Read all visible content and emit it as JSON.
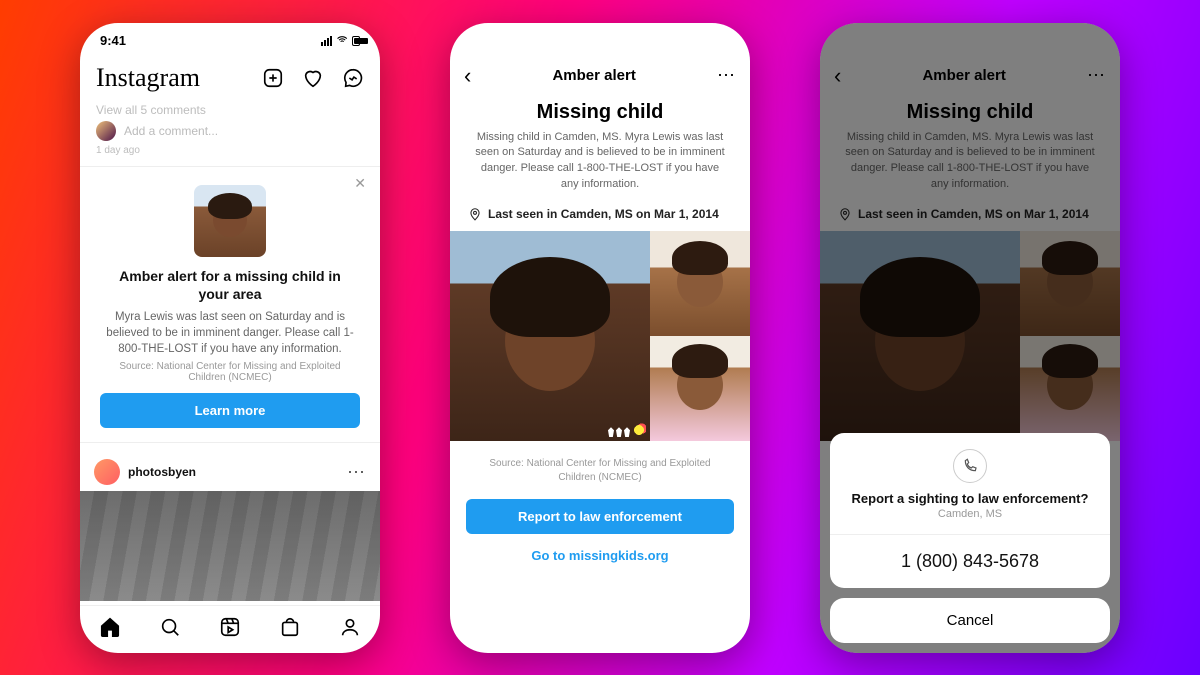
{
  "statusbar": {
    "time": "9:41"
  },
  "phone1": {
    "logo": "Instagram",
    "view_all": "View all 5 comments",
    "add_comment_placeholder": "Add a comment...",
    "timestamp": "1 day ago",
    "alert": {
      "title": "Amber alert for a missing child in your area",
      "body": "Myra Lewis was last seen on Saturday and is believed to be in imminent danger. Please call 1-800-THE-LOST if you have any information.",
      "source": "Source: National Center for Missing and Exploited Children (NCMEC)",
      "cta": "Learn more"
    },
    "post_user": "photosbyen",
    "tabs": [
      "home",
      "search",
      "reels",
      "shop",
      "profile"
    ]
  },
  "phone2": {
    "header": "Amber alert",
    "title": "Missing child",
    "desc": "Missing child in Camden, MS. Myra Lewis was last seen on Saturday and is believed to be in imminent danger. Please call 1-800-THE-LOST if you have any information.",
    "lastseen": "Last seen in Camden, MS on Mar 1, 2014",
    "source": "Source: National Center for Missing and Exploited Children (NCMEC)",
    "report_btn": "Report to law enforcement",
    "goto_link": "Go to missingkids.org"
  },
  "phone3": {
    "header": "Amber alert",
    "title": "Missing child",
    "desc": "Missing child in Camden, MS. Myra Lewis was last seen on Saturday and is believed to be in imminent danger. Please call 1-800-THE-LOST if you have any information.",
    "lastseen": "Last seen in Camden, MS on Mar 1, 2014",
    "sheet": {
      "question": "Report a sighting to law enforcement?",
      "location": "Camden, MS",
      "phone": "1 (800) 843-5678",
      "cancel": "Cancel"
    }
  }
}
